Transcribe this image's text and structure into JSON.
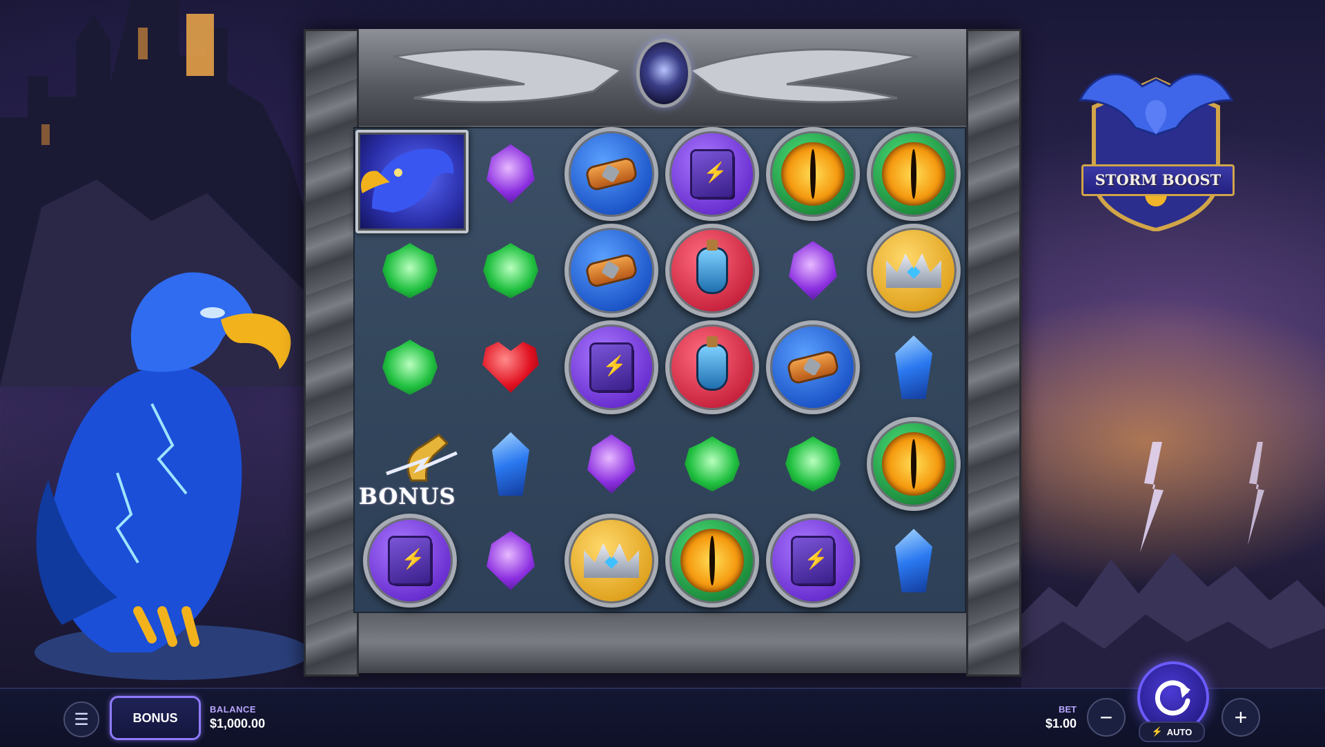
{
  "logo": {
    "title": "STORM BOOST"
  },
  "board": {
    "rows": 5,
    "cols": 6,
    "symbols": [
      [
        "eagle-wild",
        "purple-gem",
        "blue-scroll-coin",
        "purple-book-coin",
        "eye-coin",
        "eye-coin"
      ],
      [
        "green-gem",
        "green-gem",
        "blue-scroll-coin",
        "red-potion-coin",
        "purple-gem",
        "gold-crown-coin"
      ],
      [
        "green-gem",
        "red-heart",
        "purple-book-coin",
        "red-potion-coin",
        "blue-scroll-coin",
        "blue-gem"
      ],
      [
        "bonus-scatter",
        "blue-gem",
        "purple-gem",
        "green-gem",
        "green-gem",
        "eye-coin"
      ],
      [
        "purple-book-coin",
        "purple-gem",
        "gold-crown-coin",
        "eye-coin",
        "purple-book-coin",
        "blue-gem"
      ]
    ],
    "bonus_symbol_label": "BONUS"
  },
  "controls": {
    "menu_icon": "hamburger-icon",
    "bonus_button": "BONUS",
    "balance_label": "BALANCE",
    "balance_value": "$1,000.00",
    "bet_label": "BET",
    "bet_value": "$1.00",
    "minus": "−",
    "plus": "+",
    "auto_label": "AUTO",
    "spin_icon": "spin-arrow-icon"
  },
  "colors": {
    "accent": "#6c5cff",
    "bar": "#141732"
  }
}
